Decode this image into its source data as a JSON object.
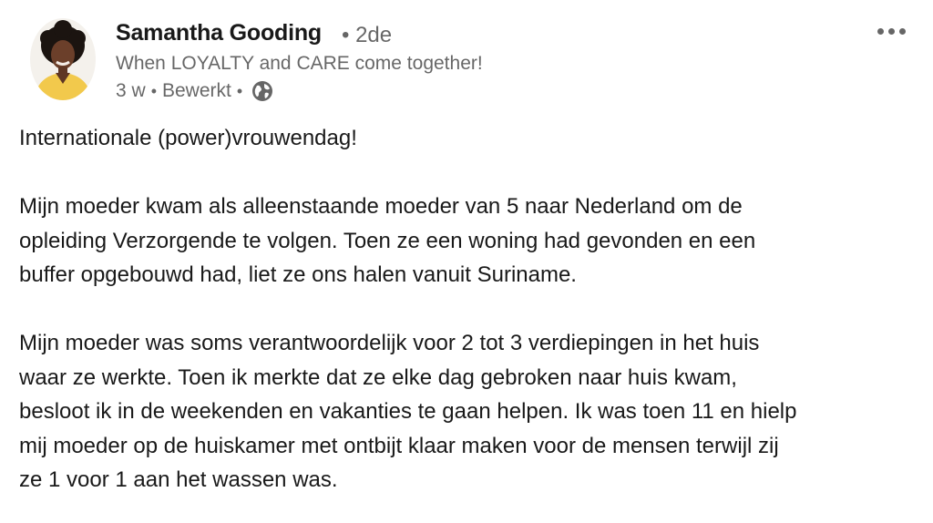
{
  "author": {
    "name": "Samantha Gooding",
    "degree": "• 2de",
    "headline": "When LOYALTY and CARE come together!",
    "time": "3 w",
    "edited": "Bewerkt",
    "visibility_icon": "globe-icon",
    "avatar_icon": "profile-photo"
  },
  "menu": {
    "icon": "more-options-icon"
  },
  "post": {
    "paragraph1": [
      "Internationale (power)vrouwendag!"
    ],
    "paragraph2": [
      "Mijn moeder kwam als alleenstaande moeder van 5 naar Nederland om de",
      "opleiding Verzorgende te volgen. Toen ze een woning had gevonden en een",
      "buffer opgebouwd had, liet ze ons halen vanuit Suriname."
    ],
    "paragraph3": [
      "Mijn moeder was soms verantwoordelijk voor 2 tot 3 verdiepingen in het huis",
      "waar ze werkte. Toen ik merkte dat ze elke dag gebroken naar huis kwam,",
      "besloot ik in de weekenden en vakanties te gaan helpen. Ik was toen 11 en hielp",
      "mij moeder op de huiskamer met ontbijt klaar maken voor de mensen terwijl zij",
      "ze 1 voor 1 aan het wassen was."
    ]
  },
  "colors": {
    "primary_text": "#191919",
    "secondary_text": "#666666",
    "avatar_shirt": "#f2c94c"
  }
}
